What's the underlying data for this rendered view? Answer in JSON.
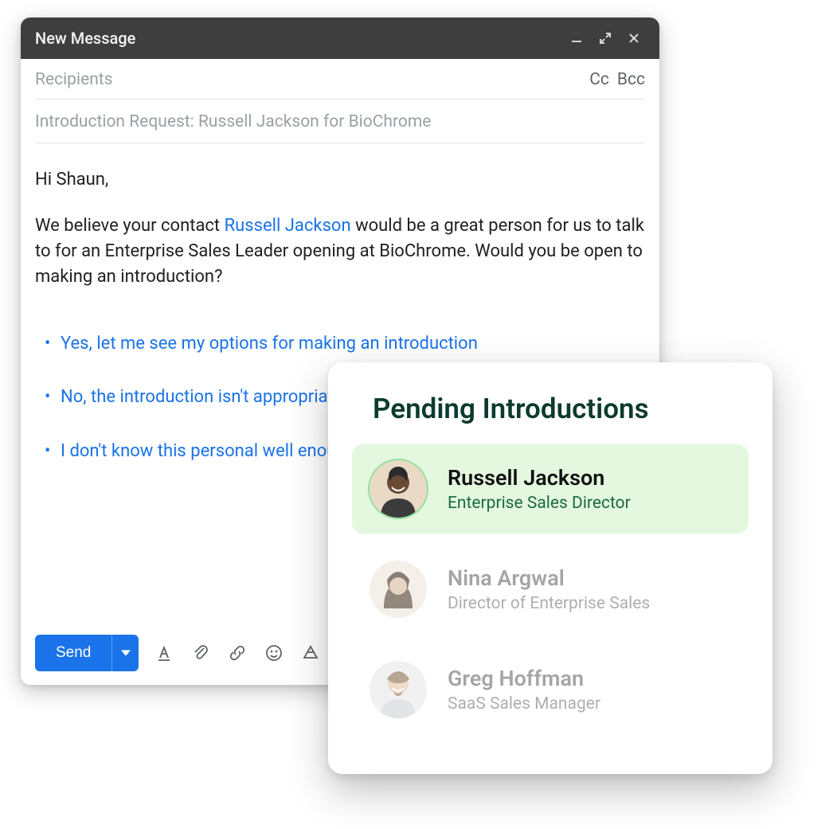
{
  "compose": {
    "window_title": "New Message",
    "recipients_placeholder": "Recipients",
    "cc_label": "Cc",
    "bcc_label": "Bcc",
    "subject": "Introduction Request: Russell Jackson for BioChrome",
    "body": {
      "greeting": "Hi Shaun,",
      "text_before_link": "We believe your contact ",
      "contact_link": "Russell Jackson",
      "text_after_link": " would be a great person for us to talk to for an Enterprise Sales Leader opening at BioChrome. Would you be open to making an introduction?"
    },
    "options": [
      "Yes, let me see my options for making an introduction",
      "No, the introduction isn't appropriate",
      "I don't know this personal well enough"
    ],
    "toolbar": {
      "send_label": "Send"
    }
  },
  "pending": {
    "title": "Pending Introductions",
    "items": [
      {
        "name": "Russell Jackson",
        "title": "Enterprise Sales Director",
        "highlight": true
      },
      {
        "name": "Nina Argwal",
        "title": "Director of Enterprise Sales",
        "highlight": false
      },
      {
        "name": "Greg Hoffman",
        "title": "SaaS Sales Manager",
        "highlight": false
      }
    ]
  },
  "colors": {
    "header_bg": "#3e3e3e",
    "link": "#1a73e8",
    "send_bg": "#1a73e8",
    "pending_title": "#0c3b2e",
    "highlight_bg": "#e4f7df",
    "highlight_title": "#1a6b3f"
  }
}
